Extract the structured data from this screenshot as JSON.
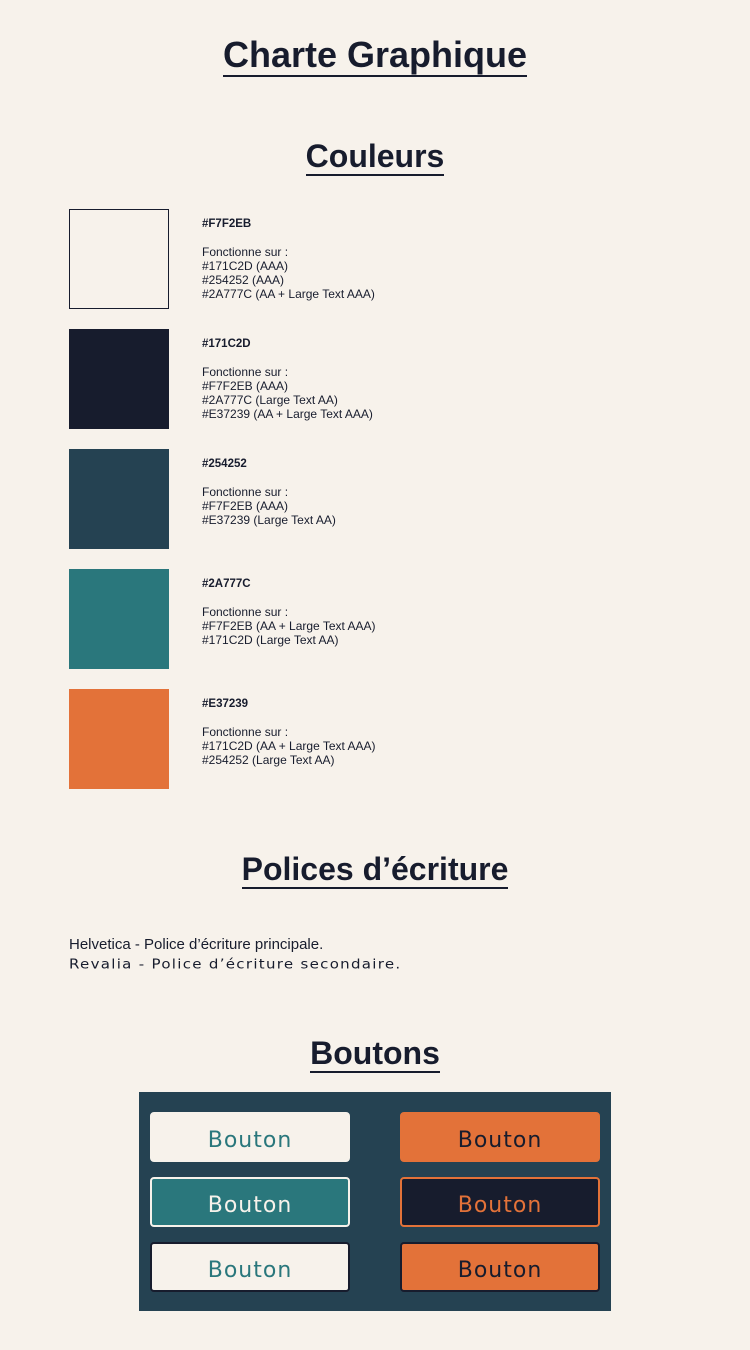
{
  "title": "Charte Graphique",
  "colors_section": {
    "title": "Couleurs",
    "swatches": [
      {
        "hex": "#F7F2EB",
        "label": "#F7F2EB",
        "works_on_label": "Fonctionne sur :",
        "lines": [
          "#171C2D (AAA)",
          "#254252 (AAA)",
          "#2A777C (AA + Large Text AAA)"
        ]
      },
      {
        "hex": "#171C2D",
        "label": "#171C2D",
        "works_on_label": "Fonctionne sur :",
        "lines": [
          "#F7F2EB (AAA)",
          "#2A777C (Large Text AA)",
          "#E37239 (AA + Large Text AAA)"
        ]
      },
      {
        "hex": "#254252",
        "label": "#254252",
        "works_on_label": "Fonctionne sur :",
        "lines": [
          "#F7F2EB (AAA)",
          "#E37239 (Large Text AA)"
        ]
      },
      {
        "hex": "#2A777C",
        "label": "#2A777C",
        "works_on_label": "Fonctionne sur :",
        "lines": [
          "#F7F2EB (AA + Large Text AAA)",
          "#171C2D (Large Text AA)"
        ]
      },
      {
        "hex": "#E37239",
        "label": "#E37239",
        "works_on_label": "Fonctionne sur :",
        "lines": [
          "#171C2D (AA + Large Text AAA)",
          "#254252 (Large Text AA)"
        ]
      }
    ]
  },
  "fonts_section": {
    "title": "Polices d’écriture",
    "primary": "Helvetica - Police d’écriture principale.",
    "secondary": "Revalia - Police d’écriture secondaire."
  },
  "buttons_section": {
    "title": "Boutons",
    "panel_color": "#254252",
    "buttons": [
      {
        "label": "Bouton",
        "bg": "#F7F2EB",
        "fg": "#2A777C",
        "border": "#F7F2EB"
      },
      {
        "label": "Bouton",
        "bg": "#E37239",
        "fg": "#171C2D",
        "border": "#E37239"
      },
      {
        "label": "Bouton",
        "bg": "#2A777C",
        "fg": "#F7F2EB",
        "border": "#F7F2EB"
      },
      {
        "label": "Bouton",
        "bg": "#171C2D",
        "fg": "#E37239",
        "border": "#E37239"
      },
      {
        "label": "Bouton",
        "bg": "#F7F2EB",
        "fg": "#2A777C",
        "border": "#171C2D"
      },
      {
        "label": "Bouton",
        "bg": "#E37239",
        "fg": "#171C2D",
        "border": "#171C2D"
      }
    ]
  }
}
